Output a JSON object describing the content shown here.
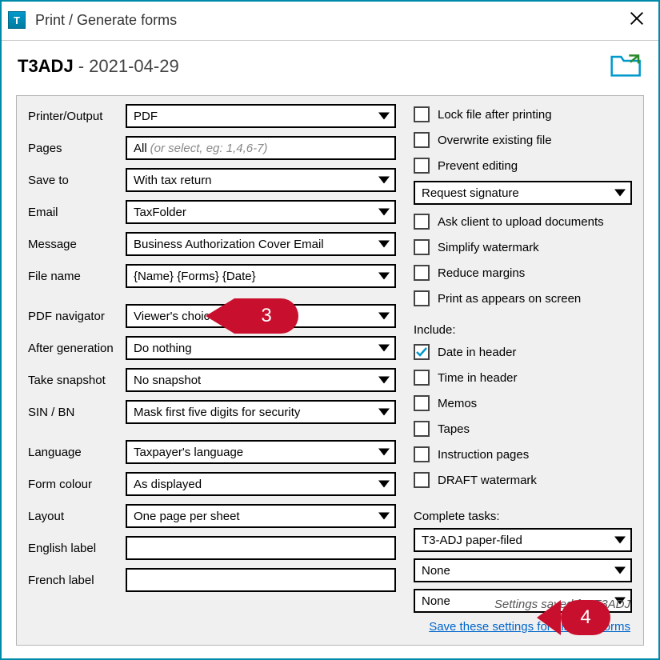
{
  "window": {
    "title": "Print / Generate forms"
  },
  "header": {
    "name": "T3ADJ",
    "date": "2021-04-29"
  },
  "left": {
    "printer_label": "Printer/Output",
    "printer_value": "PDF",
    "pages_label": "Pages",
    "pages_value": "All",
    "pages_hint": "(or select, eg: 1,4,6-7)",
    "saveto_label": "Save to",
    "saveto_value": "With tax return",
    "email_label": "Email",
    "email_value": "TaxFolder",
    "message_label": "Message",
    "message_value": "Business Authorization Cover Email",
    "filename_label": "File name",
    "filename_value": "{Name} {Forms} {Date}",
    "pdfnav_label": "PDF navigator",
    "pdfnav_value": "Viewer's choice",
    "aftergen_label": "After generation",
    "aftergen_value": "Do nothing",
    "snapshot_label": "Take snapshot",
    "snapshot_value": "No snapshot",
    "sinbn_label": "SIN / BN",
    "sinbn_value": "Mask first five digits for security",
    "language_label": "Language",
    "language_value": "Taxpayer's language",
    "formcolour_label": "Form colour",
    "formcolour_value": "As displayed",
    "layout_label": "Layout",
    "layout_value": "One page per sheet",
    "english_label": "English label",
    "english_value": "",
    "french_label": "French label",
    "french_value": ""
  },
  "right": {
    "checks_top": [
      {
        "label": "Lock file after printing",
        "checked": false
      },
      {
        "label": "Overwrite existing file",
        "checked": false
      },
      {
        "label": "Prevent editing",
        "checked": false
      }
    ],
    "request_signature": "Request signature",
    "checks_mid": [
      {
        "label": "Ask client to upload documents",
        "checked": false
      },
      {
        "label": "Simplify watermark",
        "checked": false
      },
      {
        "label": "Reduce margins",
        "checked": false
      },
      {
        "label": "Print as appears on screen",
        "checked": false
      }
    ],
    "include_label": "Include:",
    "checks_include": [
      {
        "label": "Date in header",
        "checked": true
      },
      {
        "label": "Time in header",
        "checked": false
      },
      {
        "label": "Memos",
        "checked": false
      },
      {
        "label": "Tapes",
        "checked": false
      },
      {
        "label": "Instruction pages",
        "checked": false
      },
      {
        "label": "DRAFT watermark",
        "checked": false
      }
    ],
    "complete_tasks_label": "Complete tasks:",
    "task1": "T3-ADJ paper-filed",
    "task2": "None",
    "task3": "None"
  },
  "footer": {
    "saved_note": "Settings saved for T3ADJ",
    "save_link": "Save these settings for all other forms"
  },
  "callouts": {
    "c3": "3",
    "c4": "4"
  }
}
